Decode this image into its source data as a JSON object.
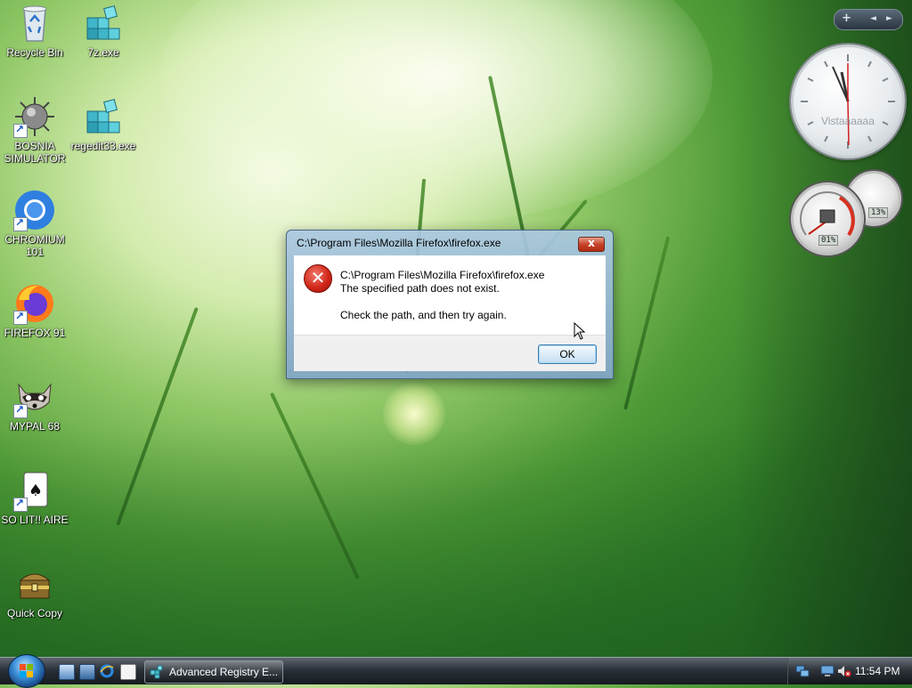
{
  "desktop": {
    "icons": [
      {
        "label": "Recycle Bin",
        "icon": "recycle-bin-icon"
      },
      {
        "label": "7z.exe",
        "icon": "registry-cubes-icon"
      },
      {
        "label": "BOSNIA SIMULATOR",
        "icon": "spiked-mine-icon"
      },
      {
        "label": "regedit33.exe",
        "icon": "registry-cubes-icon"
      },
      {
        "label": "CHROMIUM 101",
        "icon": "chromium-icon"
      },
      {
        "label": "FIREFOX 91",
        "icon": "firefox-icon"
      },
      {
        "label": "MYPAL 68",
        "icon": "raccoon-icon"
      },
      {
        "label": "SO LIT!! AIRE",
        "icon": "playing-card-icon"
      },
      {
        "label": "Quick Copy",
        "icon": "treasure-chest-icon"
      }
    ]
  },
  "gadgets": {
    "sidebar_controls": {
      "add": "+",
      "prev": "◄",
      "next": "►"
    },
    "clock_label": "Vistaaaaaa",
    "cpu_readout": "01%",
    "memory_readout": "13%"
  },
  "dialog": {
    "title": "C:\\Program Files\\Mozilla Firefox\\firefox.exe",
    "close_label": "x",
    "message_line1": "C:\\Program Files\\Mozilla Firefox\\firefox.exe",
    "message_line2": "The specified path does not exist.",
    "message_line3": "Check the path, and then try again.",
    "ok_label": "OK",
    "icon": "error-icon"
  },
  "taskbar": {
    "start": "windows-orb-icon",
    "quick_launch": [
      "show-desktop-icon",
      "switch-windows-icon",
      "internet-explorer-icon",
      "notepad-icon"
    ],
    "task_button": {
      "label": "Advanced Registry E...",
      "icon": "registry-icon"
    },
    "tray_icons": [
      "network-icon",
      "computer-icon",
      "volume-muted-icon"
    ],
    "clock": "11:54 PM"
  },
  "colors": {
    "taskbar": "#2b3138",
    "dialog_frame": "#9fbedb",
    "error_red": "#d1281a",
    "ok_border": "#3c7fb1"
  }
}
